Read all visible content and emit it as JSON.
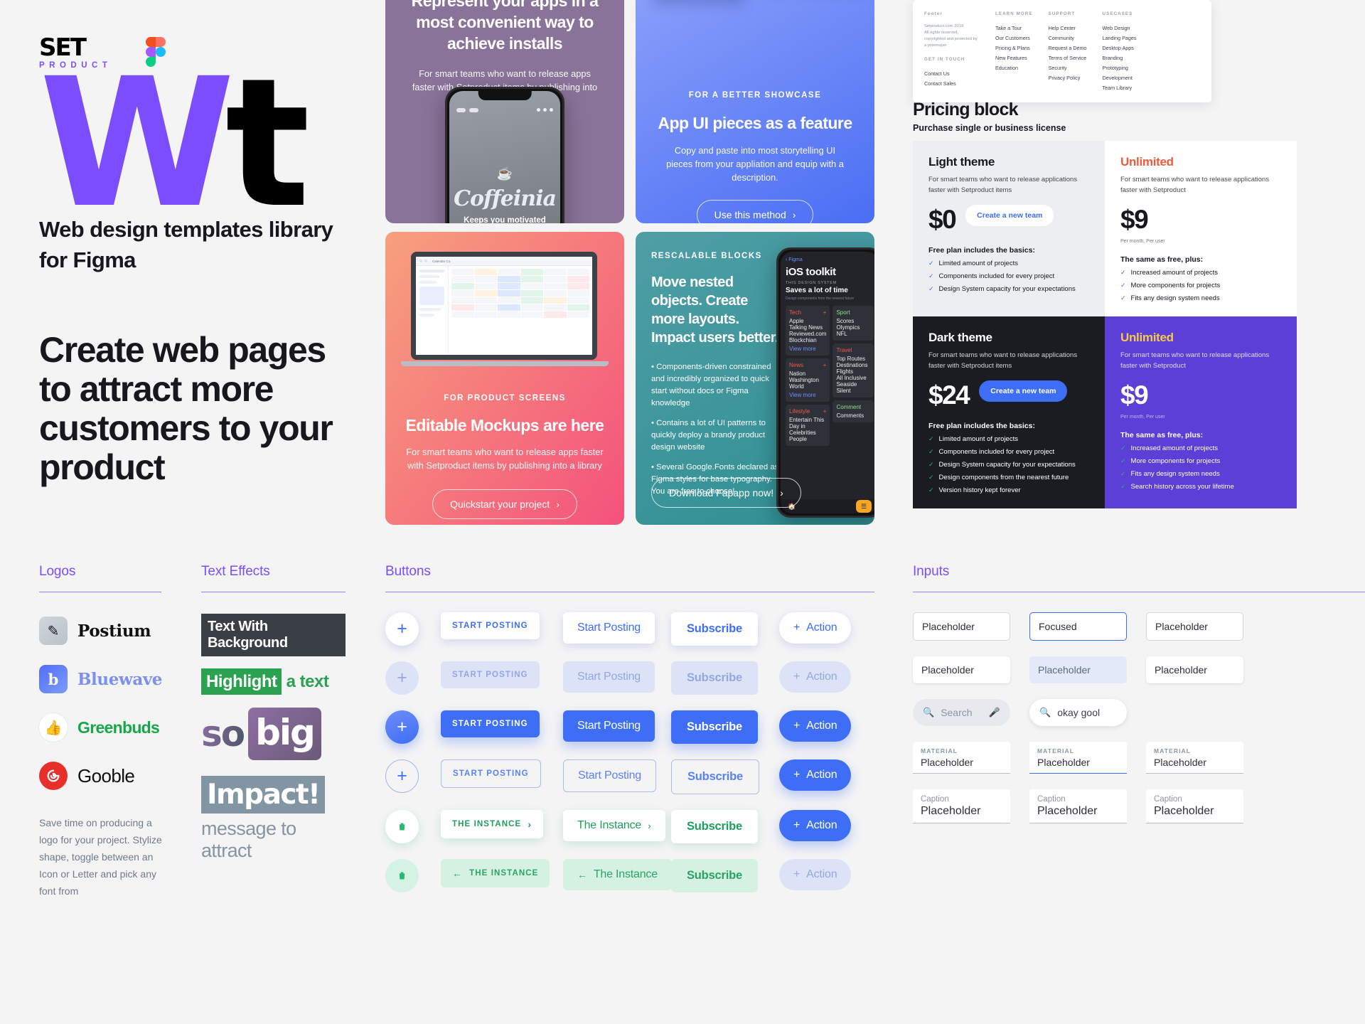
{
  "brand": {
    "logo_top": "SET",
    "logo_bottom": "PRODUCT",
    "figma_icon": "figma-logo-icon",
    "big_w": "W",
    "big_t": "t",
    "subtitle": "Web design templates library for Figma",
    "headline": "Create web pages to attract more customers to your product"
  },
  "sections": {
    "logos": "Logos",
    "text_effects": "Text Effects",
    "buttons": "Buttons",
    "inputs": "Inputs"
  },
  "logos": {
    "items": [
      {
        "badge_icon": "pen-icon",
        "badge_glyph": "✎",
        "name": "Postium"
      },
      {
        "badge_icon": "letter-b-icon",
        "badge_glyph": "b",
        "name": "Bluewave"
      },
      {
        "badge_icon": "thumbs-up-icon",
        "badge_glyph": "👍",
        "name": "Greenbuds"
      },
      {
        "badge_icon": "spiral-g-icon",
        "badge_glyph": "ɢ",
        "name": "Gooble"
      }
    ],
    "note": "Save time on producing a logo for your project. Stylize shape, toggle between an Icon or Letter and pick any font from"
  },
  "text_effects": {
    "fx1": "Text With Background",
    "fx2_highlight": "Highlight",
    "fx2_rest": "a text",
    "fx3_a": "so",
    "fx3_b": "big",
    "fx4_impact": "Impact!",
    "fx4_message": "message to attract"
  },
  "buttons": {
    "fabs": [
      {
        "glyph": "+",
        "name": "add-fab-white"
      },
      {
        "glyph": "+",
        "name": "add-fab-soft"
      },
      {
        "glyph": "+",
        "name": "add-fab-filled"
      },
      {
        "glyph": "+",
        "name": "add-fab-outline"
      },
      {
        "glyph": "🗑",
        "name": "delete-fab-white"
      },
      {
        "glyph": "🗑",
        "name": "delete-fab-soft"
      }
    ],
    "caps": [
      "START POSTING",
      "START POSTING",
      "START POSTING",
      "START POSTING",
      "THE INSTANCE",
      "THE INSTANCE"
    ],
    "normal": [
      "Start Posting",
      "Start Posting",
      "Start Posting",
      "Start Posting",
      "The Instance",
      "The Instance"
    ],
    "subscribe": [
      "Subscribe",
      "Subscribe",
      "Subscribe",
      "Subscribe",
      "Subscribe",
      "Subscribe"
    ],
    "action": [
      "Action",
      "Action",
      "Action",
      "Action",
      "Action",
      "Action"
    ],
    "chevron_right": "›",
    "arrow_left": "←",
    "plus": "+"
  },
  "inputs": {
    "rows": [
      {
        "type": "outline",
        "value": "Placeholder",
        "state": "default"
      },
      {
        "type": "outline",
        "value": "Focused",
        "state": "focused"
      },
      {
        "type": "outline",
        "value": "Placeholder",
        "state": "default"
      },
      {
        "type": "flat",
        "value": "Placeholder",
        "state": "default"
      },
      {
        "type": "flat-soft",
        "value": "Placeholder",
        "state": "default"
      },
      {
        "type": "flat",
        "value": "Placeholder",
        "state": "default"
      }
    ],
    "search_grey": {
      "placeholder": "Search",
      "icon": "search-icon",
      "mic": "microphone-icon"
    },
    "search_white": {
      "value": "okay gool",
      "icon": "search-icon"
    },
    "material": [
      {
        "label": "MATERIAL",
        "value": "Placeholder",
        "state": "default"
      },
      {
        "label": "MATERIAL",
        "value": "Placeholder",
        "state": "focused"
      },
      {
        "label": "MATERIAL",
        "value": "Placeholder",
        "state": "default"
      }
    ],
    "caption": [
      {
        "caption": "Caption",
        "value": "Placeholder"
      },
      {
        "caption": "Caption",
        "value": "Placeholder"
      },
      {
        "caption": "Caption",
        "value": "Placeholder"
      }
    ]
  },
  "cards": [
    {
      "id": "card-represent",
      "title": "Represent your apps in a most convenient way to achieve installs",
      "body": "For smart teams who want to release apps faster with Setproduct items by publishing into a library",
      "phone_app_name": "Coffeinia",
      "phone_tagline": "Keeps you motivated",
      "phone_icon": "coffee-cup-icon"
    },
    {
      "id": "card-app-ui",
      "eyebrow": "FOR A BETTER SHOWCASE",
      "title": "App UI pieces as a feature",
      "body": "Copy and paste into most storytelling UI pieces from your appliation and equip with a description.",
      "button": "Use this method"
    },
    {
      "id": "card-mockups",
      "eyebrow": "FOR PRODUCT SCREENS",
      "title": "Editable Mockups are here",
      "body": "For smart teams who want to release apps faster with Setproduct items by publishing into a library",
      "button": "Quickstart your project",
      "laptop_app": "Calendar Co."
    },
    {
      "id": "card-rescalable",
      "eyebrow": "RESCALABLE BLOCKS",
      "title": "Move nested objects. Create more layouts. Impact users better.",
      "bullets": [
        "• Components-driven constrained and incredibly organized to quick start without docs or Figma knowledge",
        "• Contains a lot of UI patterns to quickly deploy a brandy product design website",
        "• Several Google.Fonts declared as Figma styles for base typography. You are free to choose!"
      ],
      "button": "Download Fapapp now!",
      "phone": {
        "back": "‹ Figma",
        "title": "iOS toolkit",
        "subtitle": "THIS DESIGN SYSTEM",
        "tagline": "Saves a lot of time",
        "note": "Design components from the nearest future",
        "columns": [
          {
            "head": "Tech",
            "items": [
              "Apple",
              "Talking News",
              "Reviewed.com",
              "Blockchian"
            ],
            "more": "View more"
          },
          {
            "head": "News",
            "items": [
              "Nation",
              "Washington",
              "World"
            ],
            "more": "View more"
          },
          {
            "head": "Lifestyle",
            "items": [
              "Entertain This",
              "Day in Celebrities",
              "People"
            ]
          },
          {
            "head": "Sport",
            "items": [
              "Scores",
              "Olympics",
              "NFL"
            ]
          },
          {
            "head": "Travel",
            "items": [
              "Top Routes",
              "Destinations",
              "Flights",
              "All Inclusive",
              "Seaside",
              "Silent"
            ]
          },
          {
            "head": "Comment",
            "items": [
              "Comments"
            ]
          }
        ]
      }
    }
  ],
  "footer_block": {
    "title": "Footer",
    "about_logo": "Setproduct.com 2019",
    "about": "All rights reserved, copyrighted and protected by a pixemaper",
    "get_in_touch_label": "GET IN TOUCH",
    "contacts": [
      "Contact Us",
      "Contact Sales"
    ],
    "columns": [
      {
        "head": "LEARN MORE",
        "items": [
          "Take a Tour",
          "Our Customers",
          "Pricing & Plans",
          "New Features",
          "Education"
        ]
      },
      {
        "head": "SUPPORT",
        "items": [
          "Help Center",
          "Community",
          "Request a Demo",
          "Terms of Service",
          "Security",
          "Privacy Policy"
        ]
      },
      {
        "head": "USECASES",
        "items": [
          "Web Design",
          "Landing Pages",
          "Desktop Apps",
          "Branding",
          "Prototyping",
          "Development",
          "Team Library"
        ]
      }
    ]
  },
  "pricing": {
    "title": "Pricing block",
    "subtitle": "Purchase single or business license",
    "plans": [
      {
        "name": "Light theme",
        "desc": "For smart teams who want to release applications faster with Setproduct items",
        "price": "$0",
        "cta": "Create a new team",
        "note": "",
        "feat_head": "Free plan includes the basics:",
        "features": [
          "Limited amount of projects",
          "Components included for every project",
          "Design System capacity for your expectations"
        ]
      },
      {
        "name": "Unlimited",
        "desc": "For smart teams who want to release applications faster with Setproduct",
        "price": "$9",
        "cta": "",
        "note": "Per month, Per user",
        "feat_head": "The same as free, plus:",
        "features": [
          "Increased amount of projects",
          "More components for projects",
          "Fits any design system needs"
        ]
      },
      {
        "name": "Dark theme",
        "desc": "For smart teams who want to release applications faster with Setproduct items",
        "price": "$24",
        "cta": "Create a new team",
        "note": "",
        "feat_head": "Free plan includes the basics:",
        "features": [
          "Limited amount of projects",
          "Components included for every project",
          "Design System capacity for your expectations",
          "Design components from the nearest future",
          "Version history kept forever"
        ]
      },
      {
        "name": "Unlimited",
        "desc": "For smart teams who want to release applications faster with Setproduct",
        "price": "$9",
        "cta": "",
        "note": "Per month, Per user",
        "feat_head": "The same as free, plus:",
        "features": [
          "Increased amount of projects",
          "More components for projects",
          "Fits any design system needs",
          "Search history across your lifetime"
        ]
      }
    ]
  }
}
